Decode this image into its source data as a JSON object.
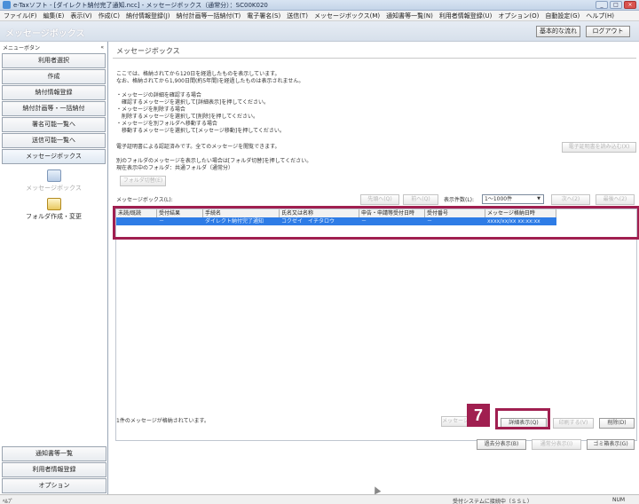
{
  "window": {
    "title": "e-Taxソフト - [ダイレクト納付完了通知.ncc] - メッセージボックス（通常分）：SC00K020",
    "controls": [
      "_",
      "□",
      "×"
    ]
  },
  "menu": [
    "ファイル(F)",
    "編集(E)",
    "表示(V)",
    "作成(C)",
    "納付情報登録(J)",
    "納付計画等一括納付(T)",
    "電子署名(S)",
    "送信(T)",
    "メッセージボックス(M)",
    "通知書等一覧(N)",
    "利用者情報登録(U)",
    "オプション(O)",
    "自動設定(G)",
    "ヘルプ(H)"
  ],
  "header": {
    "page_title": "メッセージボックス",
    "buttons": [
      "基本的な流れ",
      "ログアウト"
    ]
  },
  "sidebar": {
    "label": "メニューボタン",
    "collapse": "«",
    "items": [
      "利用者選択",
      "作成",
      "納付情報登録",
      "納付計画等・一括納付",
      "署名可能一覧へ",
      "送信可能一覧へ",
      "メッセージボックス"
    ],
    "subitems": [
      "メッセージボックス",
      "フォルダ作成・変更"
    ],
    "bottom_items": [
      "通知書等一覧",
      "利用者情報登録",
      "オプション"
    ]
  },
  "main": {
    "title": "メッセージボックス",
    "info_lines": [
      "ここでは、格納されてから120日を経過したものを表示しています。",
      "なお、格納されてから1,900日間(約5年間)を経過したものは表示されません。"
    ],
    "instruction_lines": [
      "・メッセージの詳細を確認する場合",
      "　確認するメッセージを選択して[詳細表示]を押してください。",
      "・メッセージを削除する場合",
      "　削除するメッセージを選択して[削除]を押してください。",
      "・メッセージを別フォルダへ移動する場合",
      "　移動するメッセージを選択して[メッセージ移動]を押してください。"
    ],
    "cert_line": "電子証明書による認証済みです。全てのメッセージを閲覧できます。",
    "folder_lines": [
      "別のフォルダのメッセージを表示したい場合は[フォルダ切替]を押してください。",
      "現在表示中のフォルダ：共通フォルダ（通常分）"
    ],
    "cert_read_button": "電子証明書を読み込む(X)",
    "folder_switch_button": "フォルダ切替(E)",
    "list_label": "メッセージボックス(L):",
    "paging": {
      "first": "先頭へ(Q)",
      "prev": "前へ(Q)",
      "count_label": "表示件数(L):",
      "count_value": "1～1000件",
      "next": "次へ(2)",
      "last": "最後へ(2)"
    },
    "columns": [
      "未読/既読",
      "受付結果",
      "手続名",
      "氏名又は名称",
      "申告・申請等受付日時",
      "受付番号",
      "メッセージ格納日時"
    ],
    "rows": [
      [
        "",
        "－",
        "ダイレクト納付完了通知",
        "コクゼイ　イチタロウ",
        "－",
        "－",
        "xxxx/xx/xx xx:xx:xx"
      ]
    ],
    "status_message": "1件のメッセージが格納されています。",
    "buttons_row1": [
      "メッセージ移動(M)",
      "詳細表示(Q)",
      "印刷する(V)",
      "削除(D)"
    ],
    "buttons_row2": [
      "過去分表示(B)",
      "通常分表示(I)",
      "ゴミ箱表示(G)"
    ]
  },
  "callout": {
    "number": "7"
  },
  "statusbar": {
    "left": "ﾍﾙﾌﾟ",
    "connection": "受付システムに接続中（ＳＳＬ）",
    "num": "NUM"
  }
}
